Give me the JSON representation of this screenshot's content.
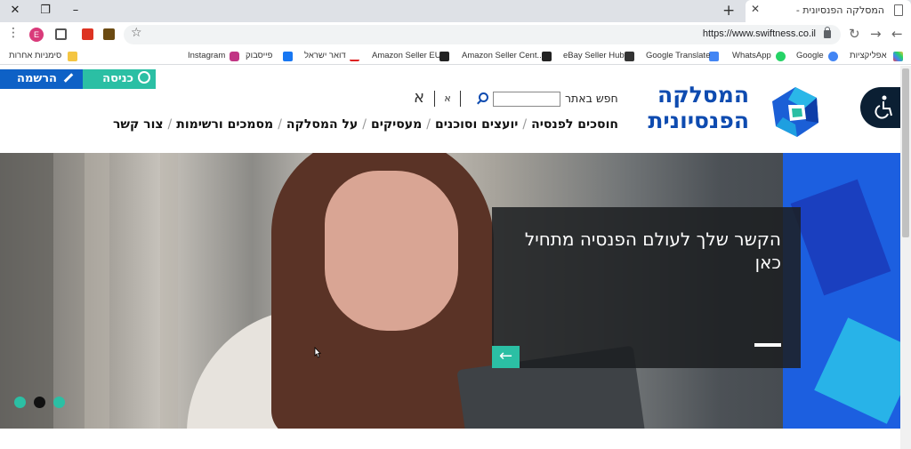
{
  "browser": {
    "tab_title": "המסלקה הפנסיונית -",
    "url": "https://www.swiftness.co.il",
    "profile_initial": "E",
    "window_controls": {
      "close": "✕",
      "restore": "❐",
      "minimize": "–"
    },
    "new_tab_icon": "+",
    "tab_close_icon": "✕",
    "bookmarks": [
      {
        "label": "אפליקציות",
        "icon": "apps-grid-icon",
        "color": "#e44"
      },
      {
        "label": "Google",
        "icon": "google-icon",
        "color": "#4285f4"
      },
      {
        "label": "WhatsApp",
        "icon": "whatsapp-icon",
        "color": "#25d366"
      },
      {
        "label": "Google Translate",
        "icon": "translate-icon",
        "color": "#4285f4"
      },
      {
        "label": "eBay Seller Hub",
        "icon": "ebay-icon",
        "color": "#333"
      },
      {
        "label": "Amazon Seller Cent...",
        "icon": "amazon-icon",
        "color": "#222"
      },
      {
        "label": "Amazon Seller EU",
        "icon": "amazon-icon",
        "color": "#222"
      },
      {
        "label": "דואר ישראל",
        "icon": "israel-post-icon",
        "color": "#d22"
      },
      {
        "label": "פייסבוק",
        "icon": "facebook-icon",
        "color": "#1877f2"
      },
      {
        "label": "Instagram",
        "icon": "instagram-icon",
        "color": "#c13584"
      }
    ],
    "other_bookmarks": "סימניות אחרות"
  },
  "site": {
    "login_label": "כניסה",
    "register_label": "הרשמה",
    "logo_line1": "המסלקה",
    "logo_line2": "הפנסיונית",
    "search_label": "חפש באתר",
    "search_placeholder": "",
    "font_small": "א",
    "font_large": "א",
    "nav": [
      "חוסכים לפנסיה",
      "יועצים וסוכנים",
      "מעסיקים",
      "על המסלקה",
      "מסמכים ורשימות",
      "צור קשר"
    ],
    "nav_separator": "/",
    "colors": {
      "brand_blue": "#0e4bb0",
      "teal": "#2bbfa4",
      "register_blue": "#0e61c6"
    }
  },
  "hero": {
    "caption": "הקשר שלך לעולם הפנסיה מתחיל כאן",
    "arrow": "←",
    "dots": [
      {
        "color": "#2bbfa4",
        "active": false
      },
      {
        "color": "#111111",
        "active": true
      },
      {
        "color": "#2bbfa4",
        "active": false
      }
    ]
  }
}
